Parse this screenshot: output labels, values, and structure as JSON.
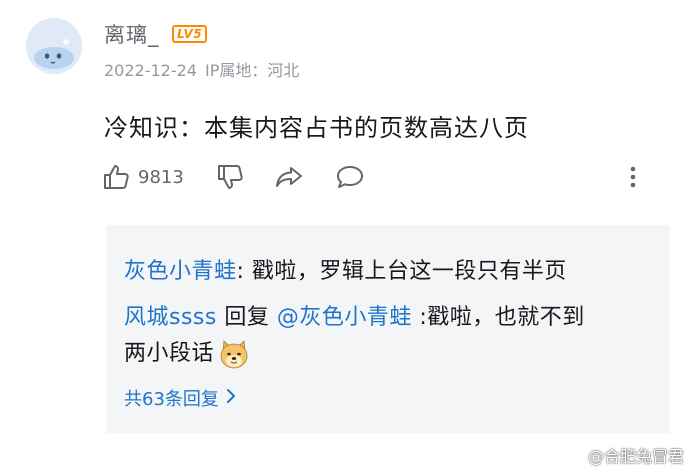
{
  "comment": {
    "username": "离璃_",
    "level_badge": "LV5",
    "date": "2022-12-24",
    "ip_location": "IP属地：河北",
    "text": "冷知识：本集内容占书的页数高达八页",
    "like_count": "9813"
  },
  "icons": {
    "like": "thumbs-up-icon",
    "dislike": "thumbs-down-icon",
    "share": "share-icon",
    "reply": "comment-icon",
    "more": "more-vertical-icon",
    "arrow": "chevron-right-icon",
    "sticker": "doge-emoji-icon",
    "watermark": "weibo-icon"
  },
  "replies": [
    {
      "user": "灰色小青蛙",
      "separator": ":",
      "text": " 戳啦，罗辑上台这一段只有半页"
    },
    {
      "user": "风城ssss",
      "reply_word": " 回复 ",
      "mention": "@灰色小青蛙",
      "text": " :戳啦，也就不到",
      "text_line2": "两小段话"
    }
  ],
  "more_replies": "共63条回复",
  "watermark": "@合肥兔冒君",
  "colors": {
    "link": "#1f75cc",
    "level_badge": "#ff8a00",
    "meta_text": "#9499a0",
    "reply_bg": "#f4f5f7"
  }
}
